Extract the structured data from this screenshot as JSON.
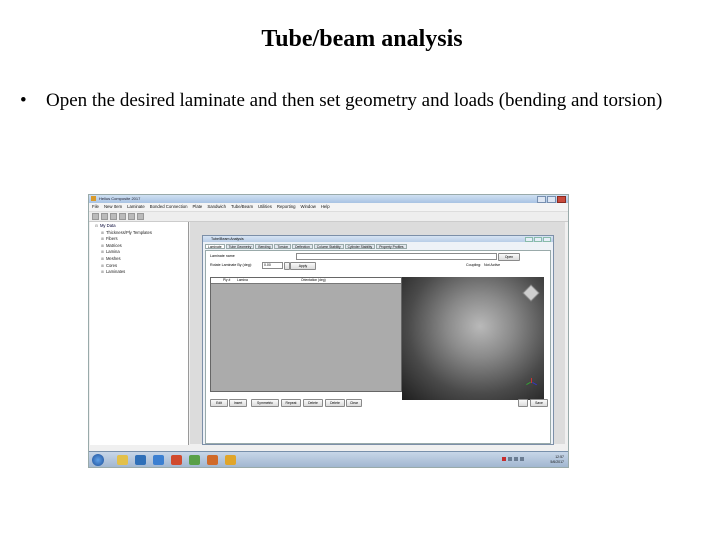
{
  "slide": {
    "title": "Tube/beam analysis",
    "bullet_symbol": "•",
    "bullet_text": "Open the desired laminate and then set geometry and loads (bending and torsion)"
  },
  "screenshot": {
    "window_title": "Helius Composite 2017",
    "menu": [
      "File",
      "New Item",
      "Laminate",
      "Bonded Connection",
      "Plate",
      "Sandwich",
      "Tube/Beam",
      "Utilities",
      "Reporting",
      "Window",
      "Help"
    ],
    "tree": {
      "root": "My Data",
      "items": [
        "Thickness/Ply Templates",
        "Fibers",
        "Matrices",
        "Lamina",
        "Meshes",
        "Cores",
        "Laminates"
      ]
    },
    "subwindow": {
      "title": "Tube/Beam Analysis",
      "tabs": [
        "Laminate",
        "Tube Geometry",
        "Bending",
        "Torsion",
        "Deflection",
        "Column Stability",
        "Cylinder Stability",
        "Property Profiles"
      ],
      "laminate_label": "Laminate name",
      "open_button": "Open",
      "rotate_label": "Rotate Laminate By (deg):",
      "rotate_value": "0.00",
      "apply_button": "Apply",
      "coupling_label": "Coupling:",
      "coupling_value": "Not Active",
      "grid_headers": [
        "Ply #",
        "Lamina",
        "Orientation (deg)"
      ],
      "bottom_buttons": [
        "Edit",
        "Insert",
        "Symmetric",
        "Repeat",
        "Delete",
        "Delete",
        "Clear"
      ],
      "save_button": "Save"
    },
    "tray_time": "12:57",
    "tray_date": "5/6/2017"
  },
  "colors": {
    "titlebar": "#a9c3e3",
    "taskbar": "#9fb5cf",
    "viewport_center": "#b9b9b9",
    "viewport_edge": "#1e1e1e"
  }
}
